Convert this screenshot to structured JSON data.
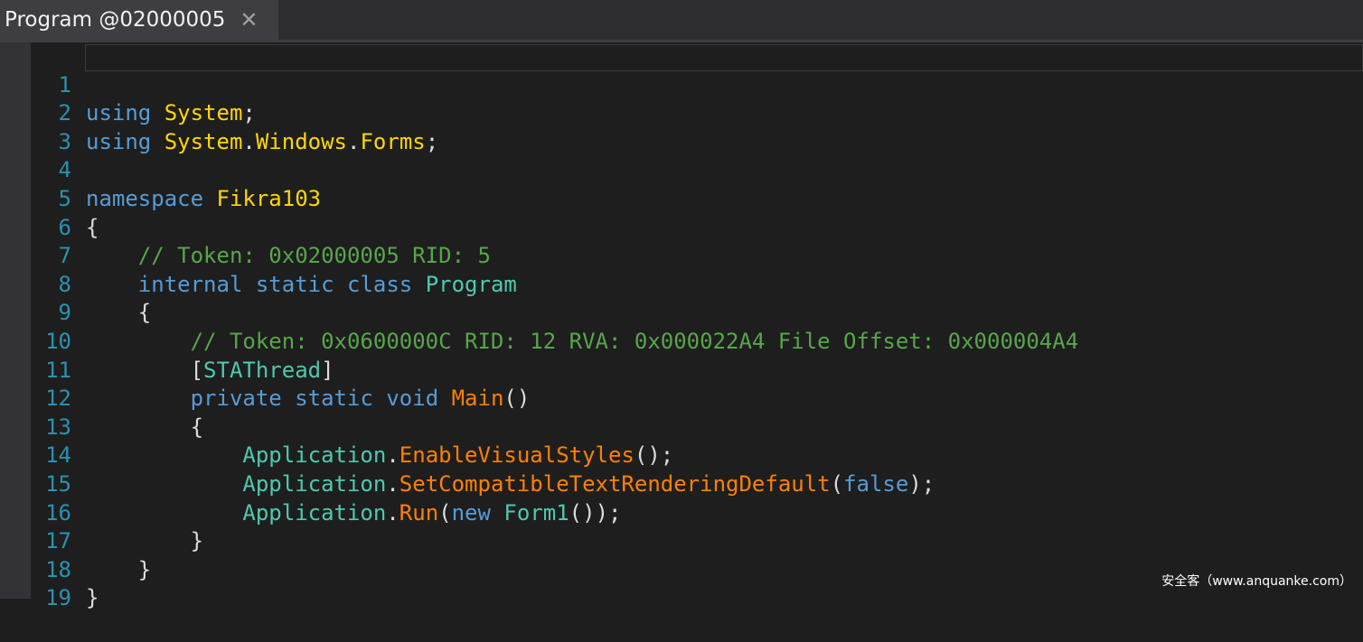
{
  "tab": {
    "title": "Program @02000005",
    "close": "✕"
  },
  "watermark": "安全客（www.anquanke.com）",
  "lines": [
    {
      "n": "1",
      "t": [
        "using",
        " ",
        "System",
        ";"
      ]
    },
    {
      "n": "2",
      "t": [
        "using",
        " ",
        "System",
        ".",
        "Windows",
        ".",
        "Forms",
        ";"
      ]
    },
    {
      "n": "3",
      "t": []
    },
    {
      "n": "4",
      "t": [
        "namespace",
        " ",
        "Fikra103"
      ]
    },
    {
      "n": "5",
      "t": [
        "{"
      ]
    },
    {
      "n": "6",
      "t": [
        "    ",
        "// Token: 0x02000005 RID: 5"
      ]
    },
    {
      "n": "7",
      "t": [
        "    ",
        "internal",
        " ",
        "static",
        " ",
        "class",
        " ",
        "Program"
      ]
    },
    {
      "n": "8",
      "t": [
        "    ",
        "{"
      ]
    },
    {
      "n": "9",
      "t": [
        "        ",
        "// Token: 0x0600000C RID: 12 RVA: 0x000022A4 File Offset: 0x000004A4"
      ]
    },
    {
      "n": "10",
      "t": [
        "        ",
        "[",
        "STAThread",
        "]"
      ]
    },
    {
      "n": "11",
      "t": [
        "        ",
        "private",
        " ",
        "static",
        " ",
        "void",
        " ",
        "Main",
        "()"
      ]
    },
    {
      "n": "12",
      "t": [
        "        ",
        "{"
      ]
    },
    {
      "n": "13",
      "t": [
        "            ",
        "Application",
        ".",
        "EnableVisualStyles",
        "();"
      ]
    },
    {
      "n": "14",
      "t": [
        "            ",
        "Application",
        ".",
        "SetCompatibleTextRenderingDefault",
        "(",
        "false",
        ");"
      ]
    },
    {
      "n": "15",
      "t": [
        "            ",
        "Application",
        ".",
        "Run",
        "(",
        "new",
        " ",
        "Form1",
        "());"
      ]
    },
    {
      "n": "16",
      "t": [
        "        ",
        "}"
      ]
    },
    {
      "n": "17",
      "t": [
        "    ",
        "}"
      ]
    },
    {
      "n": "18",
      "t": [
        "}"
      ]
    },
    {
      "n": "19",
      "t": []
    }
  ]
}
